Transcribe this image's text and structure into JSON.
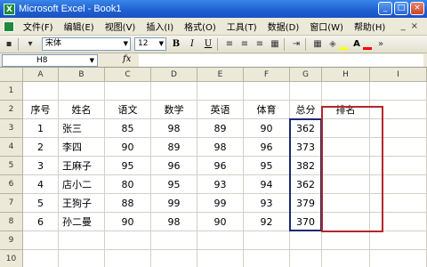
{
  "window": {
    "title": "Microsoft Excel - Book1",
    "app_icon": "excel-icon",
    "buttons": [
      "_",
      "□",
      "×"
    ]
  },
  "menubar": {
    "items": [
      "文件(F)",
      "编辑(E)",
      "视图(V)",
      "插入(I)",
      "格式(O)",
      "工具(T)",
      "数据(D)",
      "窗口(W)",
      "帮助(H)"
    ],
    "mdi_buttons": [
      "_",
      "×"
    ]
  },
  "toolbar": {
    "font_name": "宋体",
    "font_size": "12",
    "bold": "B",
    "italic": "I",
    "underline": "U",
    "fill_color": "#ffff00",
    "font_color": "#ff0000"
  },
  "formulabar": {
    "name_box": "H8",
    "fx": "fx",
    "formula": ""
  },
  "sheet": {
    "columns": [
      "A",
      "B",
      "C",
      "D",
      "E",
      "F",
      "G",
      "H",
      "I"
    ],
    "rows": [
      "1",
      "2",
      "3",
      "4",
      "5",
      "6",
      "7",
      "8",
      "9",
      "10"
    ],
    "headers": [
      "序号",
      "姓名",
      "语文",
      "数学",
      "英语",
      "体育",
      "总分",
      "排名"
    ],
    "data": [
      [
        "1",
        "张三",
        "85",
        "98",
        "89",
        "90",
        "362",
        ""
      ],
      [
        "2",
        "李四",
        "90",
        "89",
        "98",
        "96",
        "373",
        ""
      ],
      [
        "3",
        "王麻子",
        "95",
        "96",
        "96",
        "95",
        "382",
        ""
      ],
      [
        "4",
        "店小二",
        "80",
        "95",
        "93",
        "94",
        "362",
        ""
      ],
      [
        "5",
        "王狗子",
        "88",
        "99",
        "99",
        "93",
        "379",
        ""
      ],
      [
        "6",
        "孙二曼",
        "90",
        "98",
        "90",
        "92",
        "370",
        ""
      ]
    ]
  }
}
